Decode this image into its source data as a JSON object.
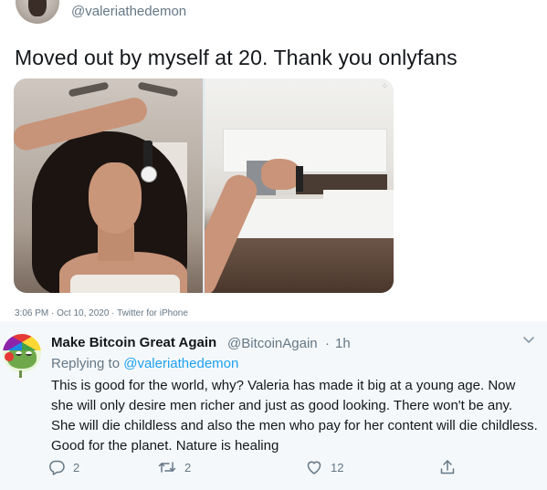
{
  "original_tweet": {
    "handle": "@valeriathedemon",
    "text": "Moved out by myself at 20. Thank you onlyfans",
    "media_watermark": "⁘",
    "timestamp": "3:06 PM · Oct 10, 2020 · Twitter for iPhone"
  },
  "reply_tweet": {
    "display_name": "Make Bitcoin Great Again",
    "handle": "@BitcoinAgain",
    "separator": "·",
    "time": "1h",
    "replying_prefix": "Replying to ",
    "replying_to": "@valeriathedemon",
    "body": "This is good for the world, why? Valeria has made it big at a young age. Now she will only desire men richer and just as good looking. There won't be any. She will die childless and also the men who pay for her content will die childless. Good for the planet. Nature is healing",
    "actions": {
      "reply_count": "2",
      "retweet_count": "2",
      "like_count": "12"
    }
  },
  "colors": {
    "accent": "#1da1f2",
    "secondary_text": "#657786",
    "reply_background": "#f5f8fa"
  },
  "icons": {
    "reply": "speech-bubble-icon",
    "retweet": "retweet-arrows-icon",
    "like": "heart-icon",
    "share": "share-upload-icon",
    "more": "chevron-down-icon"
  }
}
